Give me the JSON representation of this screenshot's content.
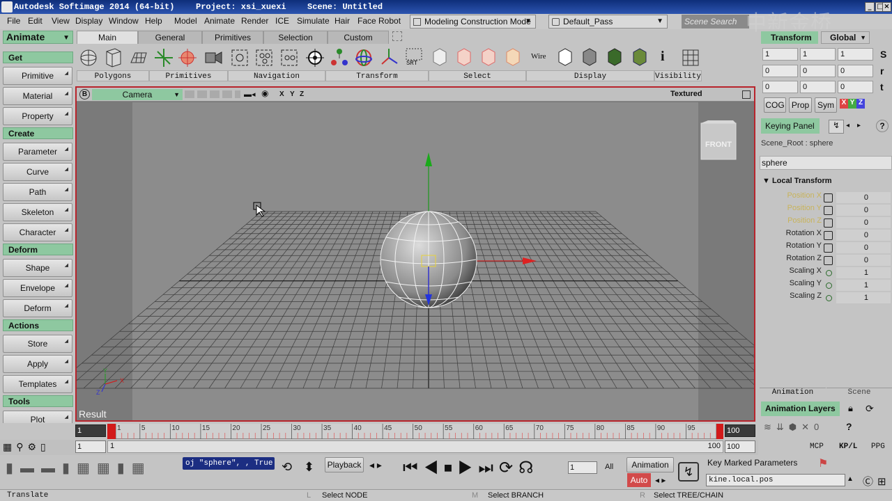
{
  "window": {
    "app_title": "Autodesk Softimage 2014 (64-bit)",
    "project": "Project: xsi_xuexi",
    "scene": "Scene: Untitled"
  },
  "menu": [
    "File",
    "Edit",
    "View",
    "Display",
    "Window",
    "Help",
    "Model",
    "Animate",
    "Render",
    "ICE",
    "Simulate",
    "Hair",
    "Face Robot"
  ],
  "mode_dropdown": "Modeling Construction Mode",
  "pass_dropdown": "Default_Pass",
  "scene_search_placeholder": "Scene Search",
  "left_panel": {
    "module": "Animate",
    "sections": [
      {
        "header": "Get",
        "items": [
          "Primitive",
          "Material",
          "Property"
        ]
      },
      {
        "header": "Create",
        "items": [
          "Parameter",
          "Curve",
          "Path",
          "Skeleton",
          "Character"
        ]
      },
      {
        "header": "Deform",
        "items": [
          "Shape",
          "Envelope",
          "Deform"
        ]
      },
      {
        "header": "Actions",
        "items": [
          "Store",
          "Apply",
          "Templates"
        ]
      },
      {
        "header": "Tools",
        "items": [
          "Plot"
        ]
      }
    ]
  },
  "toolbar_tabs": [
    "Main",
    "General",
    "Primitives",
    "Selection",
    "Custom"
  ],
  "toolbar_groups": [
    "Polygons",
    "Primitives",
    "Navigation",
    "Transform",
    "Select",
    "Display",
    "Visibility"
  ],
  "toolbar_labels": {
    "srt": "SRT",
    "wire": "Wire",
    "info": "i"
  },
  "viewport": {
    "letter": "B",
    "camera": "Camera",
    "axes": [
      "X",
      "Y",
      "Z"
    ],
    "shading": "Textured",
    "cube_label": "FRONT",
    "result_label": "Result",
    "gizmo_x": "X",
    "gizmo_y": "Y",
    "gizmo_z": "Z"
  },
  "right_panel": {
    "transform_tab": "Transform",
    "global_tab": "Global",
    "srt_rows": [
      [
        "1",
        "1",
        "1"
      ],
      [
        "0",
        "0",
        "0"
      ],
      [
        "0",
        "0",
        "0"
      ]
    ],
    "srt_letters": [
      "S",
      "r",
      "t"
    ],
    "buttons": [
      "COG",
      "Prop",
      "Sym"
    ],
    "xyz": [
      "X",
      "Y",
      "Z"
    ],
    "keying_panel": "Keying Panel",
    "help": "?",
    "path": "Scene_Root : sphere",
    "object_name": "sphere",
    "section": "Local Transform",
    "params": [
      {
        "label": "Position X",
        "value": "0",
        "yellow": true
      },
      {
        "label": "Position Y",
        "value": "0",
        "yellow": true
      },
      {
        "label": "Position Z",
        "value": "0",
        "yellow": true
      },
      {
        "label": "Rotation X",
        "value": "0",
        "yellow": false
      },
      {
        "label": "Rotation Y",
        "value": "0",
        "yellow": false
      },
      {
        "label": "Rotation Z",
        "value": "0",
        "yellow": false
      },
      {
        "label": "Scaling X",
        "value": "1",
        "yellow": false
      },
      {
        "label": "Scaling Y",
        "value": "1",
        "yellow": false
      },
      {
        "label": "Scaling Z",
        "value": "1",
        "yellow": false
      }
    ],
    "bottom_tabs": [
      "Animation",
      "Scene"
    ],
    "animation_layers": "Animation Layers",
    "mcp_tabs": [
      "MCP",
      "KP/L",
      "PPG"
    ]
  },
  "timeline": {
    "start": "1",
    "end": "100",
    "ticks": [
      "1",
      "5",
      "10",
      "15",
      "20",
      "25",
      "30",
      "35",
      "40",
      "45",
      "50",
      "55",
      "60",
      "65",
      "70",
      "75",
      "80",
      "85",
      "90",
      "95"
    ],
    "range_start": "1",
    "range_start2": "1",
    "range_end": "100",
    "range_end2": "100"
  },
  "playback": {
    "script": "oj \"sphere\", , True",
    "playback": "Playback",
    "frame": "1",
    "all": "All",
    "animation": "Animation",
    "auto": "Auto",
    "key_marked": "Key Marked Parameters",
    "kine": "kine.local.pos"
  },
  "status": {
    "tool": "Translate",
    "l_key": "L",
    "l_text": "Select NODE",
    "m_key": "M",
    "m_text": "Select BRANCH",
    "r_key": "R",
    "r_text": "Select TREE/CHAIN"
  },
  "watermark": "中新金桥"
}
